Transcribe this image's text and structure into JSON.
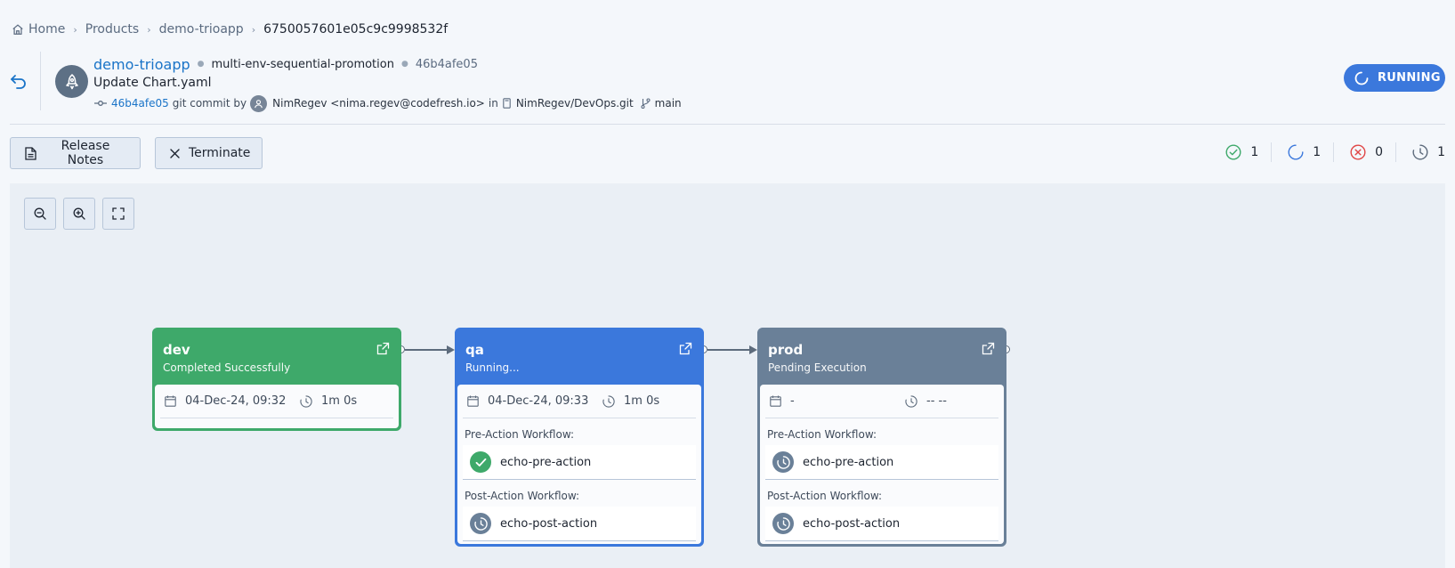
{
  "breadcrumb": {
    "home": "Home",
    "products": "Products",
    "product": "demo-trioapp",
    "current": "6750057601e05c9c9998532f"
  },
  "header": {
    "app_name": "demo-trioapp",
    "promotion_flow": "multi-env-sequential-promotion",
    "commit_hash": "46b4afe05",
    "commit_message": "Update Chart.yaml",
    "commit_short": "46b4afe05",
    "commit_text": "git commit by",
    "author": "NimRegev <nima.regev@codefresh.io>",
    "in_text": "in",
    "repo": "NimRegev/DevOps.git",
    "branch": "main",
    "status": "RUNNING"
  },
  "actions": {
    "release_notes": "Release Notes",
    "terminate": "Terminate"
  },
  "counters": {
    "succeeded": "1",
    "running": "1",
    "failed": "0",
    "pending": "1"
  },
  "environments": [
    {
      "name": "dev",
      "status": "Completed Successfully",
      "date": "04-Dec-24, 09:32",
      "duration": "1m 0s",
      "color": "#3ea96a"
    },
    {
      "name": "qa",
      "status": "Running...",
      "date": "04-Dec-24, 09:33",
      "duration": "1m 0s",
      "color": "#3b78dc",
      "pre_label": "Pre-Action Workflow:",
      "pre_workflow": "echo-pre-action",
      "post_label": "Post-Action Workflow:",
      "post_workflow": "echo-post-action"
    },
    {
      "name": "prod",
      "status": "Pending Execution",
      "date": "-",
      "duration": "-- --",
      "color": "#6a8098",
      "pre_label": "Pre-Action Workflow:",
      "pre_workflow": "echo-pre-action",
      "post_label": "Post-Action Workflow:",
      "post_workflow": "echo-post-action"
    }
  ]
}
